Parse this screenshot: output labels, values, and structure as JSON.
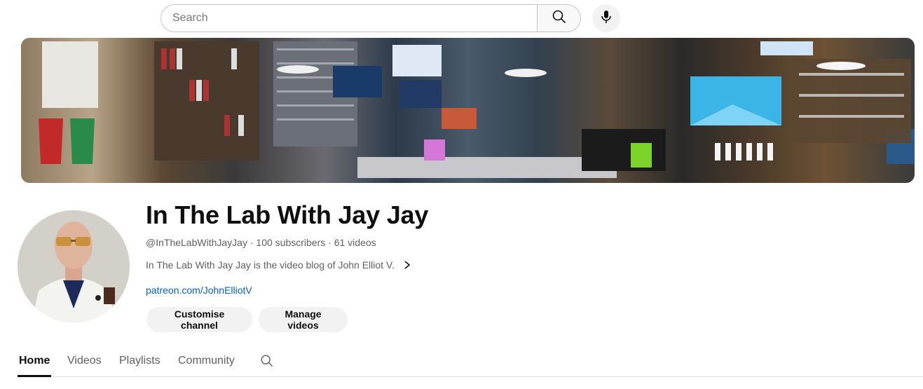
{
  "search": {
    "placeholder": "Search",
    "value": ""
  },
  "icons": {
    "search": "search-icon",
    "mic": "microphone-icon",
    "chevron": "chevron-right-icon",
    "tab_search": "search-icon"
  },
  "channel": {
    "name": "In The Lab With Jay Jay",
    "handle": "@InTheLabWithJayJay",
    "subscribers": "100 subscribers",
    "videos": "61 videos",
    "separator": " · ",
    "description": "In The Lab With Jay Jay is the video blog of John Elliot V.",
    "link": "patreon.com/JohnElliotV"
  },
  "actions": {
    "customise": "Customise channel",
    "manage": "Manage videos"
  },
  "tabs": [
    {
      "label": "Home",
      "active": true
    },
    {
      "label": "Videos",
      "active": false
    },
    {
      "label": "Playlists",
      "active": false
    },
    {
      "label": "Community",
      "active": false
    }
  ],
  "colors": {
    "link": "#065fd4",
    "pill_bg": "#f2f2f2",
    "muted_text": "#606060"
  }
}
